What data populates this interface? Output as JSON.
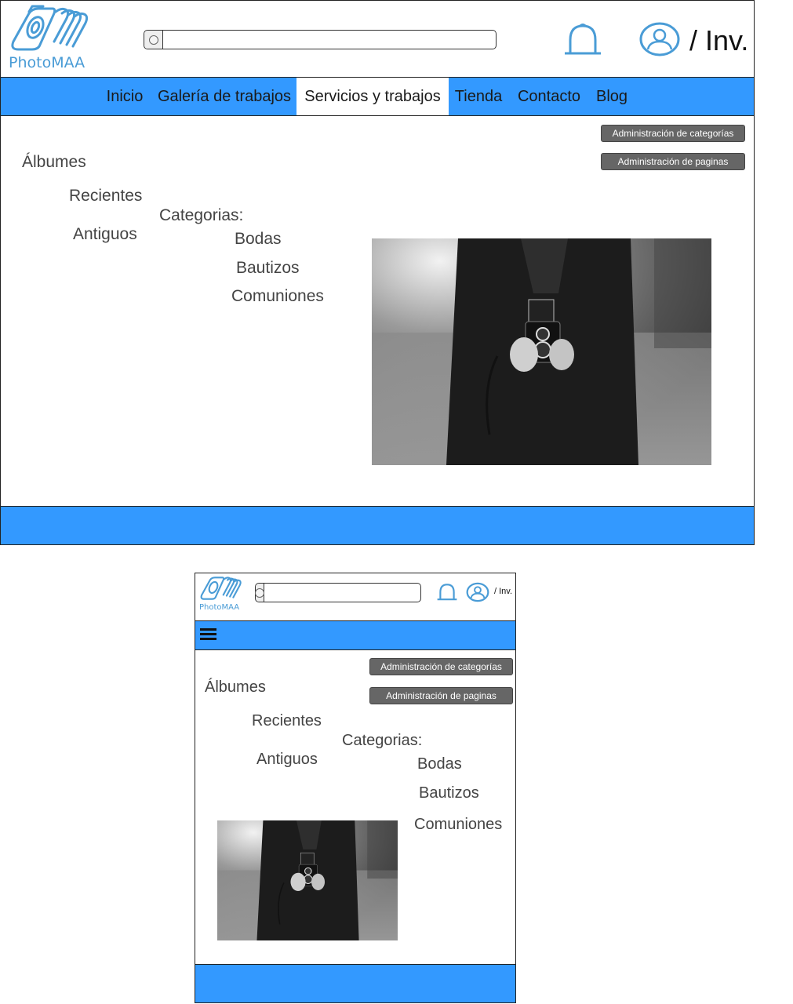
{
  "brand": {
    "name": "PhotoMAA",
    "color": "#4a9cd6"
  },
  "search": {
    "value": "",
    "placeholder": ""
  },
  "user": {
    "label": "/ Inv."
  },
  "icons": {
    "search": "search-icon",
    "bell": "bell-icon",
    "user": "user-icon",
    "menu": "hamburger-menu-icon",
    "logo": "camera-logo-icon"
  },
  "colors": {
    "nav": "#3399ff",
    "footer": "#3399ff",
    "admin_button": "#666666",
    "icon": "#4a9cd6"
  },
  "nav": {
    "items": [
      {
        "label": "Inicio"
      },
      {
        "label": "Galería de trabajos"
      },
      {
        "label": "Servicios y trabajos",
        "active": true
      },
      {
        "label": "Tienda"
      },
      {
        "label": "Contacto"
      },
      {
        "label": "Blog"
      }
    ]
  },
  "admin": {
    "categories_label": "Administración de categorías",
    "pages_label": "Administración de paginas"
  },
  "albums": {
    "title": "Álbumes",
    "items": [
      "Recientes",
      "Antiguos"
    ]
  },
  "categories": {
    "title": "Categorias:",
    "items": [
      "Bodas",
      "Bautizos",
      "Comuniones"
    ]
  },
  "photo": {
    "subject": "person holding a twin-lens reflex camera, black and white"
  }
}
